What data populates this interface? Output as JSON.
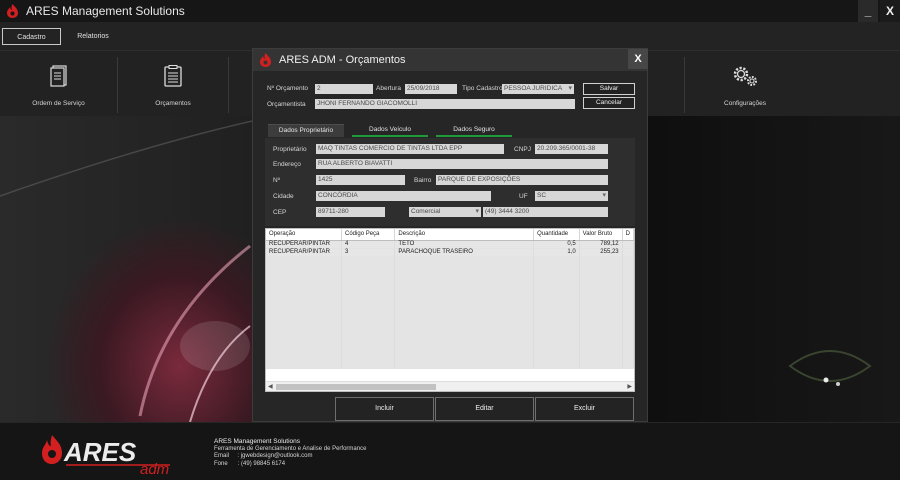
{
  "app": {
    "title": "ARES Management Solutions",
    "minimize_label": "_",
    "close_label": "X"
  },
  "menu": {
    "items": [
      {
        "label": "Cadastro"
      },
      {
        "label": "Relatorios"
      }
    ]
  },
  "ribbon": {
    "items": [
      {
        "label": "Ordem de Serviço",
        "icon": "document-icon"
      },
      {
        "label": "Orçamentos",
        "icon": "list-icon"
      },
      {
        "label": "Configurações",
        "icon": "gears-icon"
      }
    ]
  },
  "dialog": {
    "title": "ARES ADM - Orçamentos",
    "close_label": "X",
    "header": {
      "numero_label": "Nº Orçamento",
      "numero_value": "2",
      "abertura_label": "Abertura",
      "abertura_value": "25/09/2018",
      "tipo_label": "Tipo Cadastro",
      "tipo_value": "PESSOA JURIDICA",
      "orcamentista_label": "Orçamentista",
      "orcamentista_value": "JHONI FERNANDO GIACOMOLLI",
      "salvar_label": "Salvar",
      "cancelar_label": "Cancelar"
    },
    "tabs": [
      {
        "label": "Dados Proprietário"
      },
      {
        "label": "Dados Veículo"
      },
      {
        "label": "Dados Seguro"
      }
    ],
    "owner": {
      "proprietario_label": "Proprietário",
      "proprietario_value": "MAQ TINTAS COMERCIO DE TINTAS LTDA EPP",
      "cnpj_label": "CNPJ",
      "cnpj_value": "20.209.365/0001-38",
      "endereco_label": "Endereço",
      "endereco_value": "RUA ALBERTO BIAVATTI",
      "numero_label": "Nº",
      "numero_value": "1425",
      "bairro_label": "Bairro",
      "bairro_value": "PARQUE DE EXPOSIÇÕES",
      "cidade_label": "Cidade",
      "cidade_value": "CONCÓRDIA",
      "uf_label": "UF",
      "uf_value": "SC",
      "cep_label": "CEP",
      "cep_value": "89711-280",
      "phone_type_value": "Comercial",
      "phone_value": "(49) 3444 3200"
    },
    "grid": {
      "columns": [
        "Operação",
        "Código Peça",
        "Descrição",
        "Quantidade",
        "Valor Bruto",
        "D"
      ],
      "rows": [
        {
          "operacao": "RECUPERAR/PINTAR",
          "codigo": "4",
          "descricao": "TETO",
          "quantidade": "0,5",
          "valor": "789,12"
        },
        {
          "operacao": "RECUPERAR/PINTAR",
          "codigo": "3",
          "descricao": "PARACHOQUE TRASEIRO",
          "quantidade": "1,0",
          "valor": "255,23"
        }
      ]
    },
    "actions": {
      "incluir_label": "Incluir",
      "editar_label": "Editar",
      "excluir_label": "Excluir"
    }
  },
  "footer": {
    "brand_main": "ARES",
    "brand_sub": "adm",
    "company": "ARES Management Solutions",
    "tagline": "Ferramenta de Gerenciamento e Analise de Performance",
    "email_label": "Email",
    "email_value": ": jgwebdesign@outlook.com",
    "phone_label": "Fone",
    "phone_value": ":    (49) 98845 6174"
  },
  "colors": {
    "accent_green": "#1e9a3a",
    "brand_red": "#d21f1f"
  }
}
